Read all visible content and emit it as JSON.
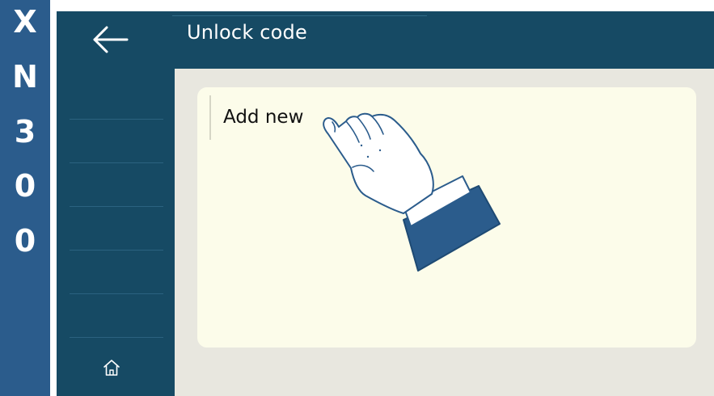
{
  "brand": {
    "letters": [
      "X",
      "N",
      "3",
      "0",
      "0"
    ]
  },
  "header": {
    "title": "Unlock code"
  },
  "list": {
    "items": [
      {
        "label": "Add new"
      }
    ]
  },
  "icons": {
    "back": "arrow-left-icon",
    "home": "home-icon",
    "pointer": "pointing-hand-icon"
  },
  "colors": {
    "brand_strip": "#2b5c8c",
    "header": "#164a64",
    "content_bg": "#e8e7df",
    "card_bg": "#fcfcea",
    "sleeve": "#2b5c8c"
  }
}
